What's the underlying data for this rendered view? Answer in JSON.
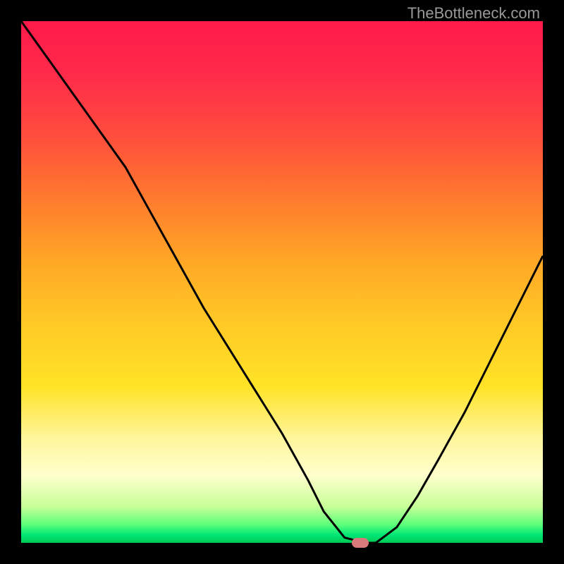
{
  "watermark": "TheBottleneck.com",
  "chart_data": {
    "type": "line",
    "title": "",
    "xlabel": "",
    "ylabel": "",
    "xlim": [
      0,
      100
    ],
    "ylim": [
      0,
      100
    ],
    "x": [
      0,
      5,
      10,
      15,
      20,
      25,
      30,
      35,
      40,
      45,
      50,
      55,
      58,
      62,
      66,
      68,
      72,
      76,
      80,
      85,
      90,
      95,
      100
    ],
    "y": [
      100,
      93,
      86,
      79,
      72,
      63,
      54,
      45,
      37,
      29,
      21,
      12,
      6,
      1,
      0,
      0,
      3,
      9,
      16,
      25,
      35,
      45,
      55
    ],
    "marker": {
      "x": 65,
      "y": 0
    },
    "background": "red-yellow-green vertical gradient",
    "grid": false
  }
}
